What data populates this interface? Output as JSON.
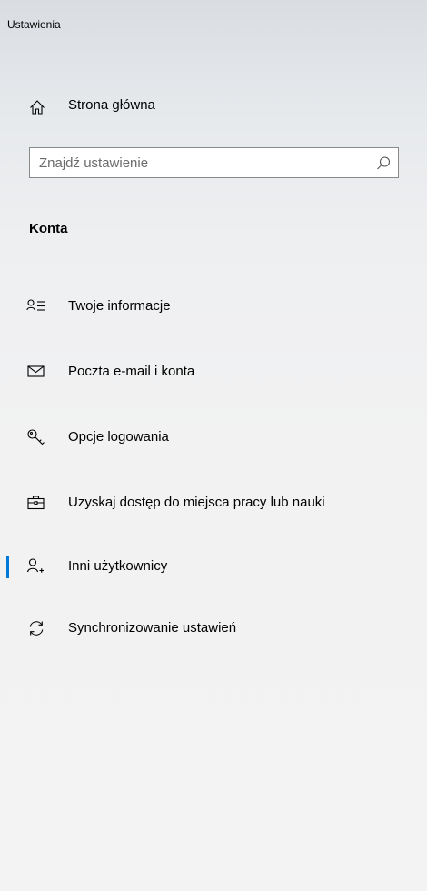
{
  "window": {
    "title": "Ustawienia"
  },
  "home": {
    "label": "Strona główna",
    "icon": "home-icon"
  },
  "search": {
    "placeholder": "Znajdź ustawienie",
    "value": "",
    "icon": "search-icon"
  },
  "section": {
    "title": "Konta"
  },
  "nav": {
    "items": [
      {
        "label": "Twoje informacje",
        "icon": "person-info-icon",
        "selected": false
      },
      {
        "label": "Poczta e-mail i konta",
        "icon": "mail-icon",
        "selected": false
      },
      {
        "label": "Opcje logowania",
        "icon": "key-icon",
        "selected": false
      },
      {
        "label": "Uzyskaj dostęp do miejsca pracy lub nauki",
        "icon": "briefcase-icon",
        "selected": false
      },
      {
        "label": "Inni użytkownicy",
        "icon": "add-person-icon",
        "selected": true
      },
      {
        "label": "Synchronizowanie ustawień",
        "icon": "sync-icon",
        "selected": false
      }
    ]
  },
  "colors": {
    "accent": "#0078d7"
  }
}
